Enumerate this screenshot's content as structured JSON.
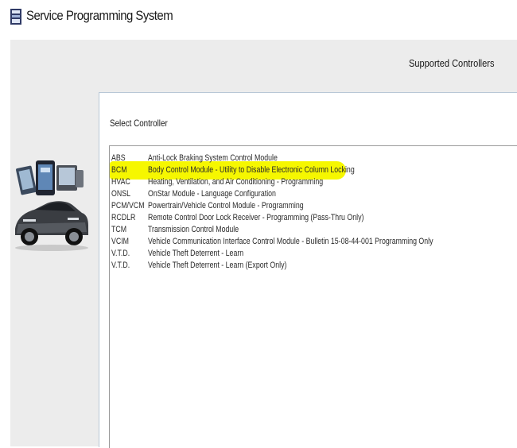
{
  "window": {
    "title": "Service Programming System",
    "icon": "gm-app-icon"
  },
  "header": {
    "label": "Supported Controllers"
  },
  "panel": {
    "title": "Select Controller"
  },
  "controllers": [
    {
      "code": "ABS",
      "description": "Anti-Lock Braking System Control Module"
    },
    {
      "code": "BCM",
      "description": "Body Control Module - Utility to Disable Electronic Column Locking",
      "highlighted": true
    },
    {
      "code": "HVAC",
      "description": "Heating, Ventilation, and Air Conditioning - Programming"
    },
    {
      "code": "ONSL",
      "description": "OnStar Module - Language Configuration"
    },
    {
      "code": "PCM/VCM",
      "description": "Powertrain/Vehicle Control Module - Programming"
    },
    {
      "code": "RCDLR",
      "description": "Remote Control Door Lock Receiver - Programming (Pass-Thru Only)"
    },
    {
      "code": "TCM",
      "description": "Transmission Control Module"
    },
    {
      "code": "VCIM",
      "description": "Vehicle Communication Interface Control Module - Bulletin 15-08-44-001 Programming Only"
    },
    {
      "code": "V.T.D.",
      "description": "Vehicle Theft Deterrent - Learn"
    },
    {
      "code": "V.T.D.",
      "description": "Vehicle Theft Deterrent - Learn (Export Only)"
    }
  ],
  "colors": {
    "highlight": "#f6f700",
    "workspace": "#ececec",
    "panel_border": "#b8c7d6"
  },
  "graphic": {
    "icon": "car-and-scan-tools-graphic"
  }
}
